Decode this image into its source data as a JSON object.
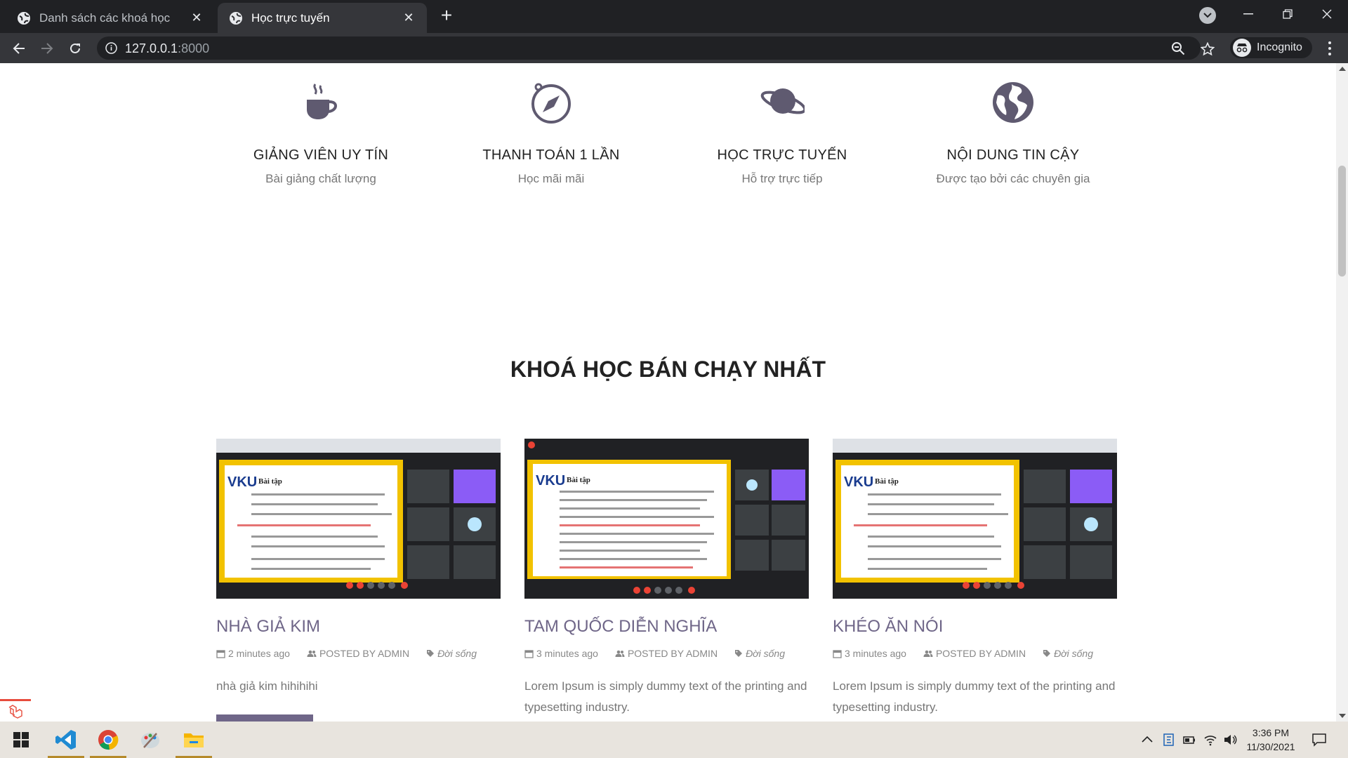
{
  "browser": {
    "tabs": [
      {
        "title": "Danh sách các khoá học",
        "active": false
      },
      {
        "title": "Học trực tuyến",
        "active": true
      }
    ],
    "url_host": "127.0.0.1",
    "url_port": ":8000",
    "profile_label": "Incognito"
  },
  "features": [
    {
      "icon": "coffee-cup-icon",
      "title": "GIẢNG VIÊN UY TÍN",
      "subtitle": "Bài giảng chất lượng"
    },
    {
      "icon": "compass-icon",
      "title": "THANH TOÁN 1 LẦN",
      "subtitle": "Học mãi mãi"
    },
    {
      "icon": "planet-icon",
      "title": "HỌC TRỰC TUYẾN",
      "subtitle": "Hỗ trợ trực tiếp"
    },
    {
      "icon": "globe-icon",
      "title": "NỘI DUNG TIN CẬY",
      "subtitle": "Được tạo bởi các chuyên gia"
    }
  ],
  "section_title": "KHOÁ HỌC BÁN CHẠY NHẤT",
  "courses": [
    {
      "title": "NHÀ GIẢ KIM",
      "time": "2 minutes ago",
      "author": "POSTED BY ADMIN",
      "category": "Đời sống",
      "description": "nhà giả kim hihihihi"
    },
    {
      "title": "TAM QUỐC DIỄN NGHĨA",
      "time": "3 minutes ago",
      "author": "POSTED BY ADMIN",
      "category": "Đời sống",
      "description": "Lorem Ipsum is simply dummy text of the printing and typesetting industry."
    },
    {
      "title": "KHÉO ĂN NÓI",
      "time": "3 minutes ago",
      "author": "POSTED BY ADMIN",
      "category": "Đời sống",
      "description": "Lorem Ipsum is simply dummy text of the printing and typesetting industry."
    }
  ],
  "thumbnail_text": {
    "brand": "VKU",
    "heading": "Bài tập"
  },
  "taskbar": {
    "apps": [
      "windows-start-icon",
      "vscode-icon",
      "chrome-icon",
      "paint-icon",
      "file-explorer-icon"
    ],
    "time": "3:36 PM",
    "date": "11/30/2021"
  },
  "colors": {
    "accent": "#6f6688",
    "chrome_dark": "#202124",
    "chrome_mid": "#35363a"
  }
}
